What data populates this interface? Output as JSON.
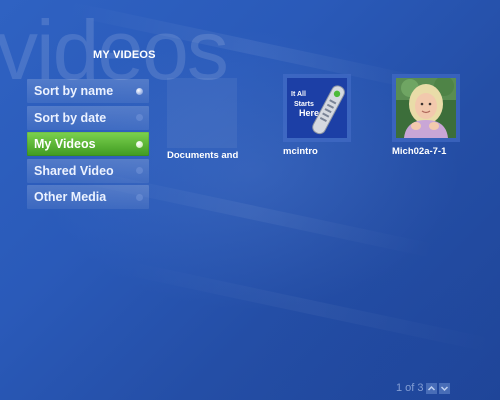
{
  "watermark": "videos",
  "section_title": "MY VIDEOS",
  "menu": [
    {
      "label": "Sort by name",
      "active": false
    },
    {
      "label": "Sort by date",
      "active": false
    },
    {
      "label": "My Videos",
      "active": true
    },
    {
      "label": "Shared Video",
      "active": false
    },
    {
      "label": "Other Media",
      "active": false
    }
  ],
  "tiles": [
    {
      "caption": "Documents and",
      "thumbnail": "blank"
    },
    {
      "caption": "mcintro",
      "thumbnail": "remote",
      "thumbnail_text": [
        "It All",
        "Starts",
        "Here"
      ]
    },
    {
      "caption": "Mich02a-7-1",
      "thumbnail": "girl-photo"
    }
  ],
  "pager": {
    "text": "1 of 3",
    "up_icon": "chevron-up-icon",
    "down_icon": "chevron-down-icon"
  },
  "colors": {
    "accent": "#4caf2a",
    "background": "#2a5ab9"
  }
}
